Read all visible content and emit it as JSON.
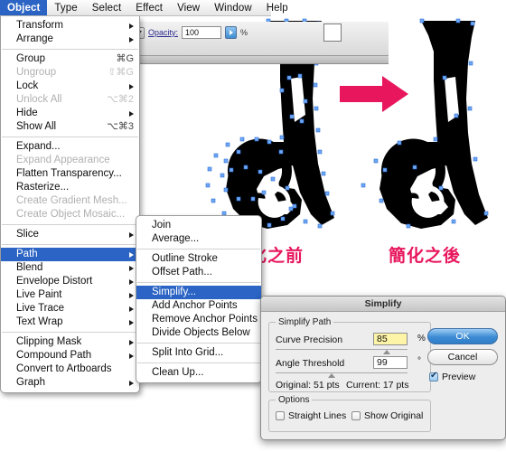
{
  "menubar": {
    "items": [
      {
        "label": "Object",
        "active": true
      },
      {
        "label": "Type",
        "active": false
      },
      {
        "label": "Select",
        "active": false
      },
      {
        "label": "Effect",
        "active": false
      },
      {
        "label": "View",
        "active": false
      },
      {
        "label": "Window",
        "active": false
      },
      {
        "label": "Help",
        "active": false
      }
    ]
  },
  "toolbar": {
    "opacity_label": "Opacity:",
    "opacity_value": "100",
    "opacity_unit": "%"
  },
  "object_menu": {
    "items": [
      {
        "label": "Transform",
        "shortcut": "",
        "submenu": true,
        "disabled": false,
        "selected": false
      },
      {
        "label": "Arrange",
        "shortcut": "",
        "submenu": true,
        "disabled": false,
        "selected": false
      },
      {
        "separator": true
      },
      {
        "label": "Group",
        "shortcut": "⌘G",
        "submenu": false,
        "disabled": false,
        "selected": false
      },
      {
        "label": "Ungroup",
        "shortcut": "⇧⌘G",
        "submenu": false,
        "disabled": true,
        "selected": false
      },
      {
        "label": "Lock",
        "shortcut": "",
        "submenu": true,
        "disabled": false,
        "selected": false
      },
      {
        "label": "Unlock All",
        "shortcut": "⌥⌘2",
        "submenu": false,
        "disabled": true,
        "selected": false
      },
      {
        "label": "Hide",
        "shortcut": "",
        "submenu": true,
        "disabled": false,
        "selected": false
      },
      {
        "label": "Show All",
        "shortcut": "⌥⌘3",
        "submenu": false,
        "disabled": false,
        "selected": false
      },
      {
        "separator": true
      },
      {
        "label": "Expand...",
        "shortcut": "",
        "submenu": false,
        "disabled": false,
        "selected": false
      },
      {
        "label": "Expand Appearance",
        "shortcut": "",
        "submenu": false,
        "disabled": true,
        "selected": false
      },
      {
        "label": "Flatten Transparency...",
        "shortcut": "",
        "submenu": false,
        "disabled": false,
        "selected": false
      },
      {
        "label": "Rasterize...",
        "shortcut": "",
        "submenu": false,
        "disabled": false,
        "selected": false
      },
      {
        "label": "Create Gradient Mesh...",
        "shortcut": "",
        "submenu": false,
        "disabled": true,
        "selected": false
      },
      {
        "label": "Create Object Mosaic...",
        "shortcut": "",
        "submenu": false,
        "disabled": true,
        "selected": false
      },
      {
        "separator": true
      },
      {
        "label": "Slice",
        "shortcut": "",
        "submenu": true,
        "disabled": false,
        "selected": false
      },
      {
        "separator": true
      },
      {
        "label": "Path",
        "shortcut": "",
        "submenu": true,
        "disabled": false,
        "selected": true
      },
      {
        "label": "Blend",
        "shortcut": "",
        "submenu": true,
        "disabled": false,
        "selected": false
      },
      {
        "label": "Envelope Distort",
        "shortcut": "",
        "submenu": true,
        "disabled": false,
        "selected": false
      },
      {
        "label": "Live Paint",
        "shortcut": "",
        "submenu": true,
        "disabled": false,
        "selected": false
      },
      {
        "label": "Live Trace",
        "shortcut": "",
        "submenu": true,
        "disabled": false,
        "selected": false
      },
      {
        "label": "Text Wrap",
        "shortcut": "",
        "submenu": true,
        "disabled": false,
        "selected": false
      },
      {
        "separator": true
      },
      {
        "label": "Clipping Mask",
        "shortcut": "",
        "submenu": true,
        "disabled": false,
        "selected": false
      },
      {
        "label": "Compound Path",
        "shortcut": "",
        "submenu": true,
        "disabled": false,
        "selected": false
      },
      {
        "label": "Convert to Artboards",
        "shortcut": "",
        "submenu": false,
        "disabled": false,
        "selected": false
      },
      {
        "label": "Graph",
        "shortcut": "",
        "submenu": true,
        "disabled": false,
        "selected": false
      }
    ]
  },
  "path_menu": {
    "items": [
      {
        "label": "Join",
        "shortcut": "",
        "submenu": false,
        "disabled": false,
        "selected": false
      },
      {
        "label": "Average...",
        "shortcut": "",
        "submenu": false,
        "disabled": false,
        "selected": false
      },
      {
        "separator": true
      },
      {
        "label": "Outline Stroke",
        "shortcut": "",
        "submenu": false,
        "disabled": false,
        "selected": false
      },
      {
        "label": "Offset Path...",
        "shortcut": "",
        "submenu": false,
        "disabled": false,
        "selected": false
      },
      {
        "separator": true
      },
      {
        "label": "Simplify...",
        "shortcut": "",
        "submenu": false,
        "disabled": false,
        "selected": true
      },
      {
        "label": "Add Anchor Points",
        "shortcut": "",
        "submenu": false,
        "disabled": false,
        "selected": false
      },
      {
        "label": "Remove Anchor Points",
        "shortcut": "",
        "submenu": false,
        "disabled": false,
        "selected": false
      },
      {
        "label": "Divide Objects Below",
        "shortcut": "",
        "submenu": false,
        "disabled": false,
        "selected": false
      },
      {
        "separator": true
      },
      {
        "label": "Split Into Grid...",
        "shortcut": "",
        "submenu": false,
        "disabled": false,
        "selected": false
      },
      {
        "separator": true
      },
      {
        "label": "Clean Up...",
        "shortcut": "",
        "submenu": false,
        "disabled": false,
        "selected": false
      }
    ]
  },
  "captions": {
    "before": "簡化之前",
    "after": "簡化之後",
    "color": "#e8175d"
  },
  "dialog": {
    "title": "Simplify",
    "group_simplify_path": "Simplify Path",
    "curve_precision_label": "Curve Precision",
    "curve_precision_value": "85",
    "curve_precision_unit": "%",
    "angle_threshold_label": "Angle Threshold",
    "angle_threshold_value": "99",
    "angle_threshold_unit": "°",
    "original_pts": "Original: 51 pts",
    "current_pts": "Current: 17 pts",
    "group_options": "Options",
    "straight_lines_label": "Straight Lines",
    "straight_lines_checked": false,
    "show_original_label": "Show Original",
    "show_original_checked": false,
    "ok_label": "OK",
    "cancel_label": "Cancel",
    "preview_label": "Preview",
    "preview_checked": true
  },
  "artwork": {
    "glyph": "A",
    "anchor_color": "#6fa8f5",
    "fill_color": "#000000",
    "arrow_color": "#e8175d"
  }
}
